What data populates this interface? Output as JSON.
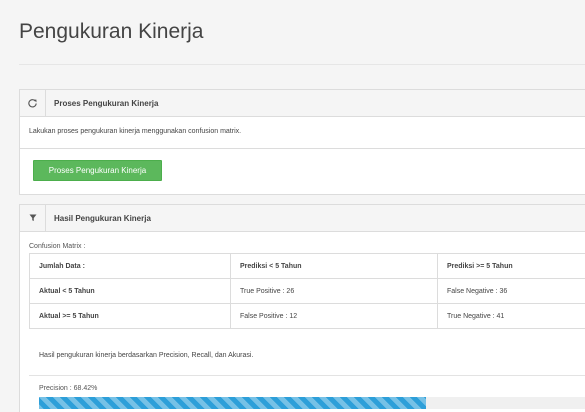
{
  "page": {
    "title": "Pengukuran Kinerja"
  },
  "process_panel": {
    "icon": "refresh-icon",
    "heading": "Proses Pengukuran Kinerja",
    "description": "Lakukan proses pengukuran kinerja menggunakan confusion matrix.",
    "button_label": "Proses Pengukuran Kinerja",
    "button_color": "#5cb85c"
  },
  "result_panel": {
    "icon": "filter-icon",
    "heading": "Hasil Pengukuran Kinerja",
    "matrix_label": "Confusion Matrix :",
    "headers": [
      "Jumlah Data :",
      "Prediksi < 5 Tahun",
      "Prediksi >= 5 Tahun"
    ],
    "rows": [
      [
        "Aktual < 5 Tahun",
        "True Positive : 26",
        "False Negative : 36"
      ],
      [
        "Aktual >= 5 Tahun",
        "False Positive : 12",
        "True Negative : 41"
      ]
    ],
    "summary_text": "Hasil pengukuran kinerja berdasarkan Precision, Recall, dan Akurasi.",
    "precision_label": "Precision : 68.42%",
    "precision_value": 68.42,
    "progress_color": "#2d9fd9"
  }
}
